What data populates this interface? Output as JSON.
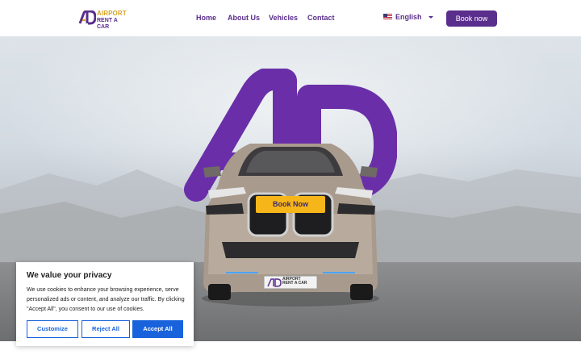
{
  "header": {
    "logo": {
      "line1": "AIRPORT",
      "line2": "RENT A CAR"
    },
    "nav": [
      {
        "label": "Home"
      },
      {
        "label": "About Us"
      },
      {
        "label": "Vehicles"
      },
      {
        "label": "Contact"
      }
    ],
    "language": "English",
    "book_label": "Book now"
  },
  "hero": {
    "book_label": "Book Now",
    "plate_line1": "AIRPORT",
    "plate_line2": "RENT A CAR"
  },
  "cookie": {
    "title": "We value your privacy",
    "text": "We use cookies to enhance your browsing experience, serve personalized ads or content, and analyze our traffic. By clicking \"Accept All\", you consent to our use of cookies.",
    "customize_label": "Customize",
    "reject_label": "Reject All",
    "accept_label": "Accept All"
  },
  "colors": {
    "brand_purple": "#5a2e8c",
    "brand_gold": "#d7a526",
    "hero_button": "#f6b619",
    "cookie_blue": "#1863dc"
  },
  "icons": {
    "flag": "us-flag-icon",
    "caret": "chevron-down-icon"
  }
}
